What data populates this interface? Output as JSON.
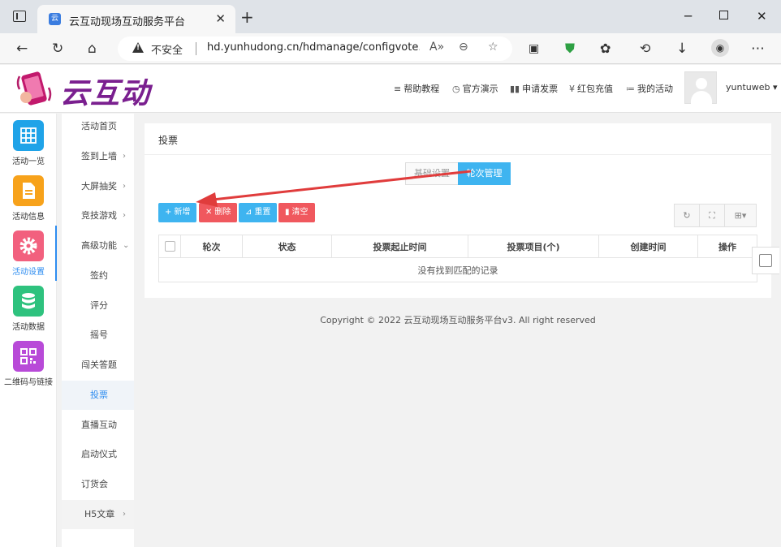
{
  "browser": {
    "tab_title": "云互动现场互动服务平台",
    "insecure_label": "不安全",
    "url": "hd.yunhudong.cn/hdmanage/configvote...",
    "favicon_letter": "云"
  },
  "header": {
    "logo_text": "云互动",
    "nav": [
      {
        "icon": "≡",
        "label": "帮助教程"
      },
      {
        "icon": "◷",
        "label": "官方演示"
      },
      {
        "icon": "▮▮",
        "label": "申请发票"
      },
      {
        "icon": "¥",
        "label": "红包充值"
      },
      {
        "icon": "≔",
        "label": "我的活动"
      }
    ],
    "username": "yuntuweb",
    "caret": "▾"
  },
  "rail": [
    {
      "label": "活动一览",
      "color": "#1fa3e8",
      "icon": "grid-icon"
    },
    {
      "label": "活动信息",
      "color": "#f7a21b",
      "icon": "document-icon"
    },
    {
      "label": "活动设置",
      "color": "#f2607e",
      "icon": "gear-icon"
    },
    {
      "label": "活动数据",
      "color": "#2ec27e",
      "icon": "database-icon"
    },
    {
      "label": "二维码与链接",
      "color": "#b84ad8",
      "icon": "qrcode-icon"
    }
  ],
  "submenu": [
    {
      "label": "活动首页",
      "arrow": ""
    },
    {
      "label": "签到上墙",
      "arrow": "›"
    },
    {
      "label": "大屏抽奖",
      "arrow": "›"
    },
    {
      "label": "竞技游戏",
      "arrow": "›"
    },
    {
      "label": "高级功能",
      "arrow": "⌄"
    },
    {
      "label": "签约",
      "arrow": ""
    },
    {
      "label": "评分",
      "arrow": ""
    },
    {
      "label": "摇号",
      "arrow": ""
    },
    {
      "label": "闯关答题",
      "arrow": ""
    },
    {
      "label": "投票",
      "arrow": ""
    },
    {
      "label": "直播互动",
      "arrow": ""
    },
    {
      "label": "启动仪式",
      "arrow": ""
    },
    {
      "label": "订货会",
      "arrow": ""
    },
    {
      "label": "H5文章",
      "arrow": "›"
    }
  ],
  "panel": {
    "title": "投票",
    "switch": [
      "基础设置",
      "轮次管理"
    ],
    "buttons": [
      {
        "icon": "+",
        "label": "新增"
      },
      {
        "icon": "✕",
        "label": "删除"
      },
      {
        "icon": "⊿",
        "label": "重置"
      },
      {
        "icon": "▮",
        "label": "清空"
      }
    ],
    "tools": [
      "↻",
      "⛶",
      "⊞▾"
    ],
    "columns": [
      "轮次",
      "状态",
      "投票起止时间",
      "投票项目(个)",
      "创建时间",
      "操作"
    ],
    "empty_text": "没有找到匹配的记录"
  },
  "footer": "Copyright © 2022 云互动现场互动服务平台v3. All right reserved",
  "annotation_color": "#e03c3c"
}
